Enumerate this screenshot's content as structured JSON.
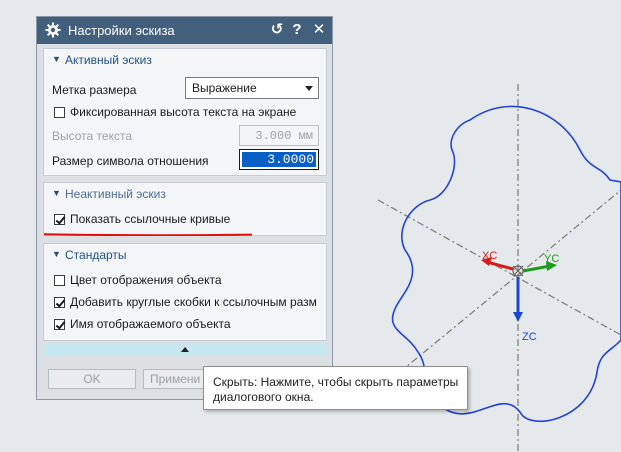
{
  "dialog": {
    "title": "Настройки эскиза",
    "title_buttons": {
      "reset": "↺",
      "help": "?",
      "close": "✕"
    },
    "sections": {
      "active": {
        "header": "Активный эскиз",
        "dimension_label_label": "Метка размера",
        "dimension_label_value": "Выражение",
        "fixed_text_height_label": "Фиксированная высота текста на экране",
        "fixed_text_height_checked": false,
        "text_height_label": "Высота текста",
        "text_height_value": "3.000 мм",
        "relation_symbol_size_label": "Размер символа отношения",
        "relation_symbol_size_value": "3.0000"
      },
      "inactive": {
        "header": "Неактивный эскиз",
        "show_reference_curves_label": "Показать ссылочные кривые",
        "show_reference_curves_checked": true
      },
      "standards": {
        "header": "Стандарты",
        "object_color_label": "Цвет отображения объекта",
        "object_color_checked": false,
        "parentheses_label": "Добавить круглые скобки к ссылочным разм",
        "parentheses_checked": true,
        "object_name_label": "Имя отображаемого объекта",
        "object_name_checked": true
      }
    },
    "buttons": {
      "ok": "OK",
      "apply": "Примени"
    }
  },
  "tooltip": {
    "line1": "Скрыть: Нажмите, чтобы скрыть параметры",
    "line2": "диалогового окна."
  },
  "viewport": {
    "axis_labels": {
      "xc": "XC",
      "yc": "YC",
      "zc": "ZC"
    },
    "colors": {
      "curve": "#2343d6",
      "xc": "#d41c1c",
      "yc": "#1c9c1c",
      "zc": "#1a45d0",
      "datum": "#7a7a6a",
      "annotation": "#e01010",
      "titlebar": "#42607c"
    }
  }
}
